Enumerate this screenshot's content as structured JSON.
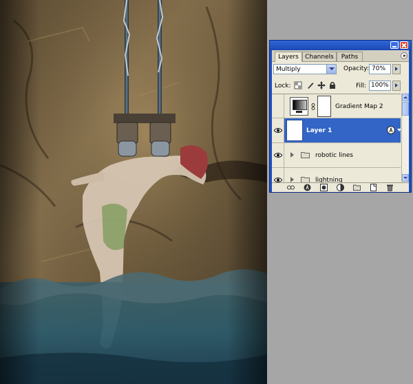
{
  "panel": {
    "tabs": [
      "Layers",
      "Channels",
      "Paths"
    ],
    "active_tab": "Layers",
    "blend_mode": "Multiply",
    "opacity_label": "Opacity:",
    "opacity_value": "70%",
    "lock_label": "Lock:",
    "fill_label": "Fill:",
    "fill_value": "100%",
    "layers": [
      {
        "name": "Gradient Map 2",
        "visible": false,
        "type": "adjustment"
      },
      {
        "name": "Layer 1",
        "visible": true,
        "selected": true,
        "type": "pixel"
      },
      {
        "name": "robotic lines",
        "visible": true,
        "type": "group"
      },
      {
        "name": "lightning",
        "visible": true,
        "type": "group"
      }
    ]
  },
  "icons": {
    "lock": [
      "lock-transparent-icon",
      "lock-image-icon",
      "lock-position-icon",
      "lock-all-icon"
    ],
    "bottom": [
      "link-icon",
      "fx-icon",
      "mask-icon",
      "adjustment-icon",
      "folder-icon",
      "new-layer-icon",
      "trash-icon"
    ]
  },
  "colors": {
    "title_bar": "#1e4fbf",
    "panel_bg": "#ece9d8",
    "selection": "#3265c6",
    "desktop": "#a6a6a6"
  }
}
